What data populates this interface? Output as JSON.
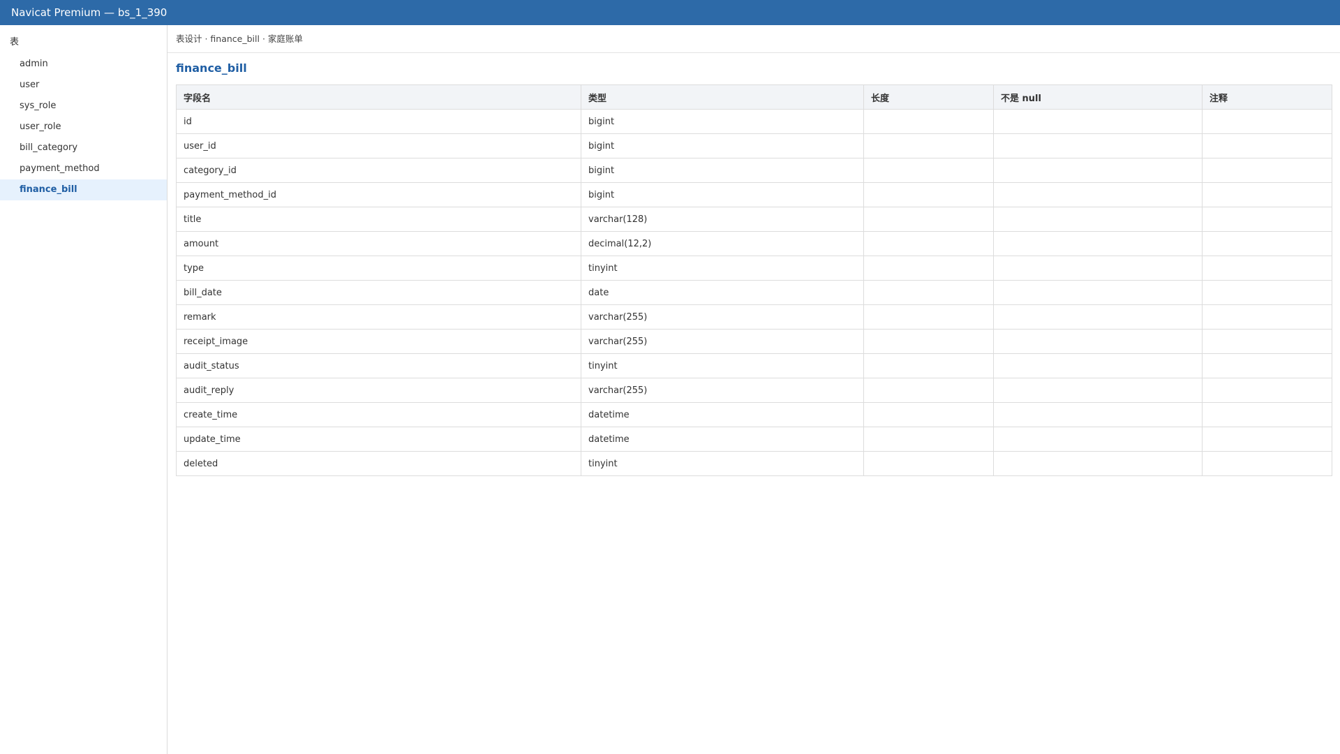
{
  "window": {
    "title": "Navicat Premium — bs_1_390"
  },
  "sidebar": {
    "header": "表",
    "items": [
      {
        "label": "admin",
        "active": false
      },
      {
        "label": "user",
        "active": false
      },
      {
        "label": "sys_role",
        "active": false
      },
      {
        "label": "user_role",
        "active": false
      },
      {
        "label": "bill_category",
        "active": false
      },
      {
        "label": "payment_method",
        "active": false
      },
      {
        "label": "finance_bill",
        "active": true
      }
    ]
  },
  "main": {
    "breadcrumb": "表设计 · finance_bill · 家庭账单",
    "table_title": "finance_bill",
    "columns": [
      "字段名",
      "类型",
      "长度",
      "不是 null",
      "注释"
    ],
    "rows": [
      [
        "id",
        "bigint",
        "",
        "",
        ""
      ],
      [
        "user_id",
        "bigint",
        "",
        "",
        ""
      ],
      [
        "category_id",
        "bigint",
        "",
        "",
        ""
      ],
      [
        "payment_method_id",
        "bigint",
        "",
        "",
        ""
      ],
      [
        "title",
        "varchar(128)",
        "",
        "",
        ""
      ],
      [
        "amount",
        "decimal(12,2)",
        "",
        "",
        ""
      ],
      [
        "type",
        "tinyint",
        "",
        "",
        ""
      ],
      [
        "bill_date",
        "date",
        "",
        "",
        ""
      ],
      [
        "remark",
        "varchar(255)",
        "",
        "",
        ""
      ],
      [
        "receipt_image",
        "varchar(255)",
        "",
        "",
        ""
      ],
      [
        "audit_status",
        "tinyint",
        "",
        "",
        ""
      ],
      [
        "audit_reply",
        "varchar(255)",
        "",
        "",
        ""
      ],
      [
        "create_time",
        "datetime",
        "",
        "",
        ""
      ],
      [
        "update_time",
        "datetime",
        "",
        "",
        ""
      ],
      [
        "deleted",
        "tinyint",
        "",
        "",
        ""
      ]
    ]
  },
  "colors": {
    "titlebar": "#2d6aa8",
    "accent": "#1f5ea4",
    "active_item_bg": "#e6f1fd",
    "table_header_bg": "#f2f4f7"
  }
}
